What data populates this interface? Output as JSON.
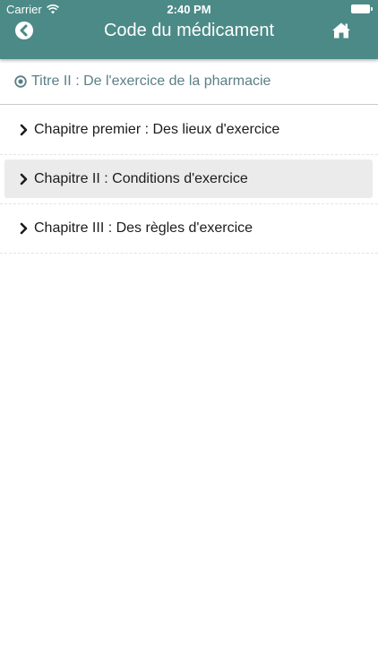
{
  "status_bar": {
    "carrier": "Carrier",
    "time": "2:40 PM"
  },
  "header": {
    "title": "Code du médicament",
    "back_icon": "back-circle-icon",
    "home_icon": "home-icon",
    "background_color": "#4b8a87"
  },
  "section": {
    "title": "Titre II : De l'exercice de la pharmacie",
    "icon": "target-icon",
    "color": "#5a7f86"
  },
  "chapters": [
    {
      "label": "Chapitre premier : Des lieux d'exercice",
      "selected": false
    },
    {
      "label": "Chapitre II : Conditions d'exercice",
      "selected": true
    },
    {
      "label": "Chapitre III : Des règles d'exercice",
      "selected": false
    }
  ]
}
